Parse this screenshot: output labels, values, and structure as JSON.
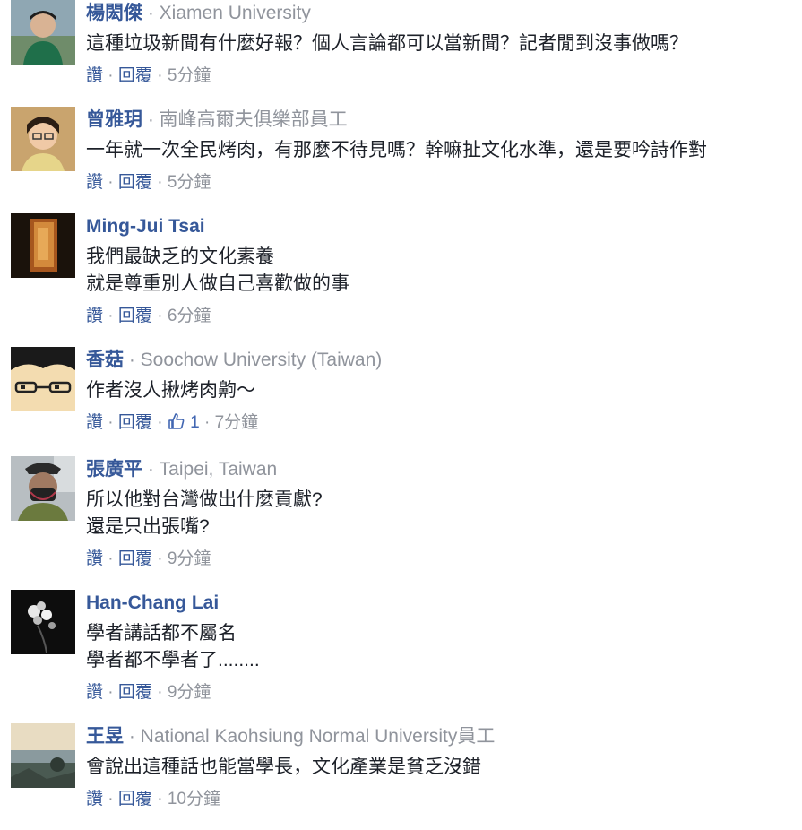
{
  "comments": [
    {
      "author": "楊閎傑",
      "affiliation": "Xiamen University",
      "lines": [
        "這種垃圾新聞有什麼好報？個人言論都可以當新聞？記者閒到沒事做嗎？"
      ],
      "like_label": "讚",
      "reply_label": "回覆",
      "time": "5分鐘",
      "avatar_icon": "profile-photo-man-green-shirt"
    },
    {
      "author": "曾雅玥",
      "affiliation": "南峰高爾夫俱樂部員工",
      "lines": [
        "一年就一次全民烤肉，有那麼不待見嗎？幹嘛扯文化水準，還是要吟詩作對"
      ],
      "like_label": "讚",
      "reply_label": "回覆",
      "time": "5分鐘",
      "avatar_icon": "profile-photo-woman-glasses"
    },
    {
      "author": "Ming-Jui Tsai",
      "affiliation": "",
      "lines": [
        "我們最缺乏的文化素養",
        "就是尊重別人做自己喜歡做的事"
      ],
      "like_label": "讚",
      "reply_label": "回覆",
      "time": "6分鐘",
      "avatar_icon": "profile-photo-dark-amber"
    },
    {
      "author": "香菇",
      "affiliation": "Soochow University (Taiwan)",
      "lines": [
        "作者沒人揪烤肉齁～"
      ],
      "like_label": "讚",
      "reply_label": "回覆",
      "reaction_count": "1",
      "time": "7分鐘",
      "avatar_icon": "profile-cartoon-glasses"
    },
    {
      "author": "張廣平",
      "affiliation": "Taipei, Taiwan",
      "lines": [
        "所以他對台灣做出什麼貢獻?",
        "還是只出張嘴?"
      ],
      "like_label": "讚",
      "reply_label": "回覆",
      "time": "9分鐘",
      "avatar_icon": "profile-photo-masked-man"
    },
    {
      "author": "Han-Chang Lai",
      "affiliation": "",
      "lines": [
        "學者講話都不屬名",
        "學者都不學者了........"
      ],
      "like_label": "讚",
      "reply_label": "回覆",
      "time": "9分鐘",
      "avatar_icon": "profile-photo-white-flowers"
    },
    {
      "author": "王昱",
      "affiliation": "National Kaohsiung Normal University員工",
      "lines": [
        "會說出這種話也能當學長，文化產業是貧乏沒錯"
      ],
      "like_label": "讚",
      "reply_label": "回覆",
      "time": "10分鐘",
      "avatar_icon": "profile-photo-seaside"
    }
  ],
  "colors": {
    "author": "#365899",
    "meta": "#90949c",
    "text": "#1d2129",
    "reaction": "#4267b2"
  }
}
